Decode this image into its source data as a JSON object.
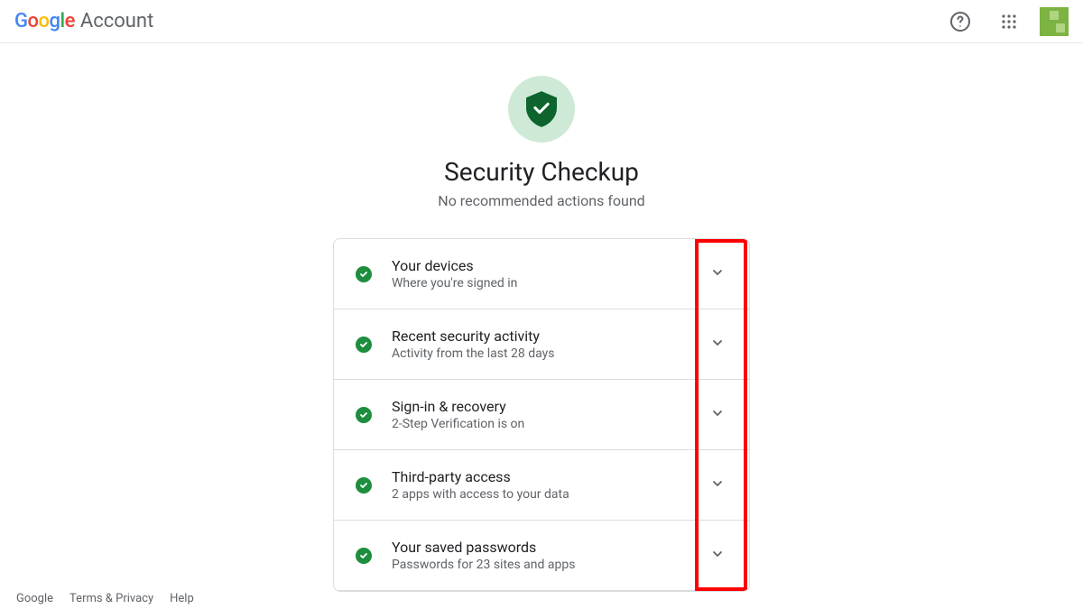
{
  "header": {
    "logo_text": "Google",
    "account_label": "Account"
  },
  "page": {
    "title": "Security Checkup",
    "subtitle": "No recommended actions found"
  },
  "items": [
    {
      "title": "Your devices",
      "subtitle": "Where you're signed in"
    },
    {
      "title": "Recent security activity",
      "subtitle": "Activity from the last 28 days"
    },
    {
      "title": "Sign-in & recovery",
      "subtitle": "2-Step Verification is on"
    },
    {
      "title": "Third-party access",
      "subtitle": "2 apps with access to your data"
    },
    {
      "title": "Your saved passwords",
      "subtitle": "Passwords for 23 sites and apps"
    }
  ],
  "footer": {
    "google": "Google",
    "terms": "Terms & Privacy",
    "help": "Help"
  }
}
